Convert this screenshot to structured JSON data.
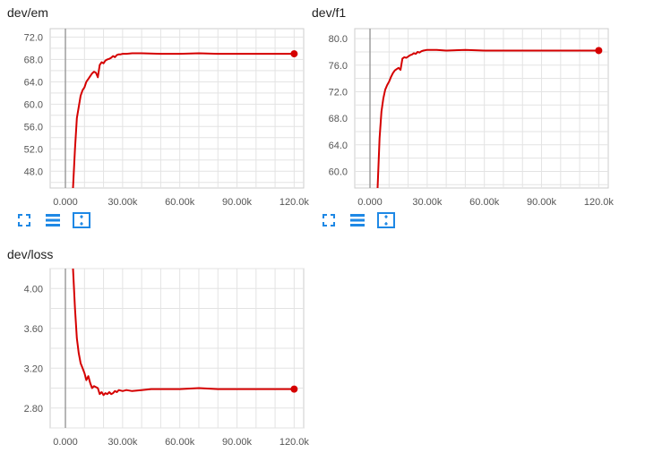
{
  "colors": {
    "series": "#d50000",
    "grid": "#e3e3e3",
    "zero_axis": "#9e9e9e",
    "icon": "#1e88e5",
    "frame": "#cccccc"
  },
  "icons": [
    "expand-icon",
    "list-icon",
    "fit-domain-icon"
  ],
  "chart_data": [
    {
      "type": "line",
      "title": "dev/em",
      "xlim": [
        -8000,
        125000
      ],
      "ylim": [
        45,
        73.5
      ],
      "x_ticks": [
        0,
        30000,
        60000,
        90000,
        120000
      ],
      "x_tick_labels": [
        "0.000",
        "30.00k",
        "60.00k",
        "90.00k",
        "120.0k"
      ],
      "y_ticks": [
        48,
        52,
        56,
        60,
        64,
        68,
        72
      ],
      "y_tick_labels": [
        "48.0",
        "52.0",
        "56.0",
        "60.0",
        "64.0",
        "68.0",
        "72.0"
      ],
      "grid": true,
      "series": [
        {
          "x": [
            4000,
            5000,
            6000,
            7000,
            8000,
            9000,
            10000,
            11000,
            12000,
            13000,
            14000,
            15000,
            16000,
            17000,
            18000,
            19000,
            20000,
            21000,
            22000,
            23000,
            24000,
            25000,
            26000,
            27000,
            28000,
            29000,
            30000,
            32000,
            35000,
            40000,
            50000,
            60000,
            70000,
            80000,
            90000,
            100000,
            110000,
            120000
          ],
          "y": [
            45,
            52,
            57.5,
            59.5,
            61.5,
            62.5,
            63,
            64,
            64.5,
            65,
            65.5,
            65.8,
            65.6,
            64.8,
            67,
            67.5,
            67.3,
            67.8,
            68,
            68.1,
            68.3,
            68.6,
            68.4,
            68.8,
            68.9,
            68.9,
            69,
            69,
            69.1,
            69.1,
            69,
            69,
            69.1,
            69,
            69,
            69,
            69,
            69
          ]
        }
      ]
    },
    {
      "type": "line",
      "title": "dev/f1",
      "xlim": [
        -8000,
        125000
      ],
      "ylim": [
        57.5,
        81.5
      ],
      "x_ticks": [
        0,
        30000,
        60000,
        90000,
        120000
      ],
      "x_tick_labels": [
        "0.000",
        "30.00k",
        "60.00k",
        "90.00k",
        "120.0k"
      ],
      "y_ticks": [
        60,
        64,
        68,
        72,
        76,
        80
      ],
      "y_tick_labels": [
        "60.0",
        "64.0",
        "68.0",
        "72.0",
        "76.0",
        "80.0"
      ],
      "grid": true,
      "series": [
        {
          "x": [
            4000,
            5000,
            6000,
            7000,
            8000,
            9000,
            10000,
            11000,
            12000,
            13000,
            14000,
            15000,
            16000,
            17000,
            18000,
            19000,
            20000,
            21000,
            22000,
            23000,
            24000,
            25000,
            26000,
            27000,
            28000,
            30000,
            35000,
            40000,
            50000,
            60000,
            70000,
            80000,
            90000,
            100000,
            110000,
            120000
          ],
          "y": [
            57.5,
            65,
            69,
            71,
            72.3,
            73,
            73.5,
            74.2,
            74.8,
            75.2,
            75.4,
            75.6,
            75.3,
            77,
            77.2,
            77.1,
            77.3,
            77.5,
            77.6,
            77.8,
            77.7,
            78,
            77.9,
            78.1,
            78.2,
            78.3,
            78.3,
            78.2,
            78.3,
            78.2,
            78.2,
            78.2,
            78.2,
            78.2,
            78.2,
            78.2
          ]
        }
      ]
    },
    {
      "type": "line",
      "title": "dev/loss",
      "xlim": [
        -8000,
        125000
      ],
      "ylim": [
        2.6,
        4.2
      ],
      "x_ticks": [
        0,
        30000,
        60000,
        90000,
        120000
      ],
      "x_tick_labels": [
        "0.000",
        "30.00k",
        "60.00k",
        "90.00k",
        "120.0k"
      ],
      "y_ticks": [
        2.8,
        3.2,
        3.6,
        4.0
      ],
      "y_tick_labels": [
        "2.80",
        "3.20",
        "3.60",
        "4.00"
      ],
      "grid": true,
      "series": [
        {
          "x": [
            4000,
            5000,
            6000,
            7000,
            8000,
            9000,
            10000,
            11000,
            12000,
            13000,
            14000,
            15000,
            16000,
            17000,
            18000,
            19000,
            20000,
            21000,
            22000,
            23000,
            24000,
            25000,
            26000,
            27000,
            28000,
            30000,
            32000,
            35000,
            40000,
            45000,
            50000,
            60000,
            70000,
            80000,
            90000,
            100000,
            110000,
            120000
          ],
          "y": [
            4.2,
            3.8,
            3.5,
            3.35,
            3.25,
            3.2,
            3.15,
            3.08,
            3.12,
            3.05,
            3.0,
            3.02,
            3.01,
            3.0,
            2.94,
            2.96,
            2.93,
            2.95,
            2.94,
            2.96,
            2.94,
            2.95,
            2.97,
            2.96,
            2.98,
            2.97,
            2.98,
            2.97,
            2.98,
            2.99,
            2.99,
            2.99,
            3.0,
            2.99,
            2.99,
            2.99,
            2.99,
            2.99
          ]
        }
      ]
    }
  ]
}
